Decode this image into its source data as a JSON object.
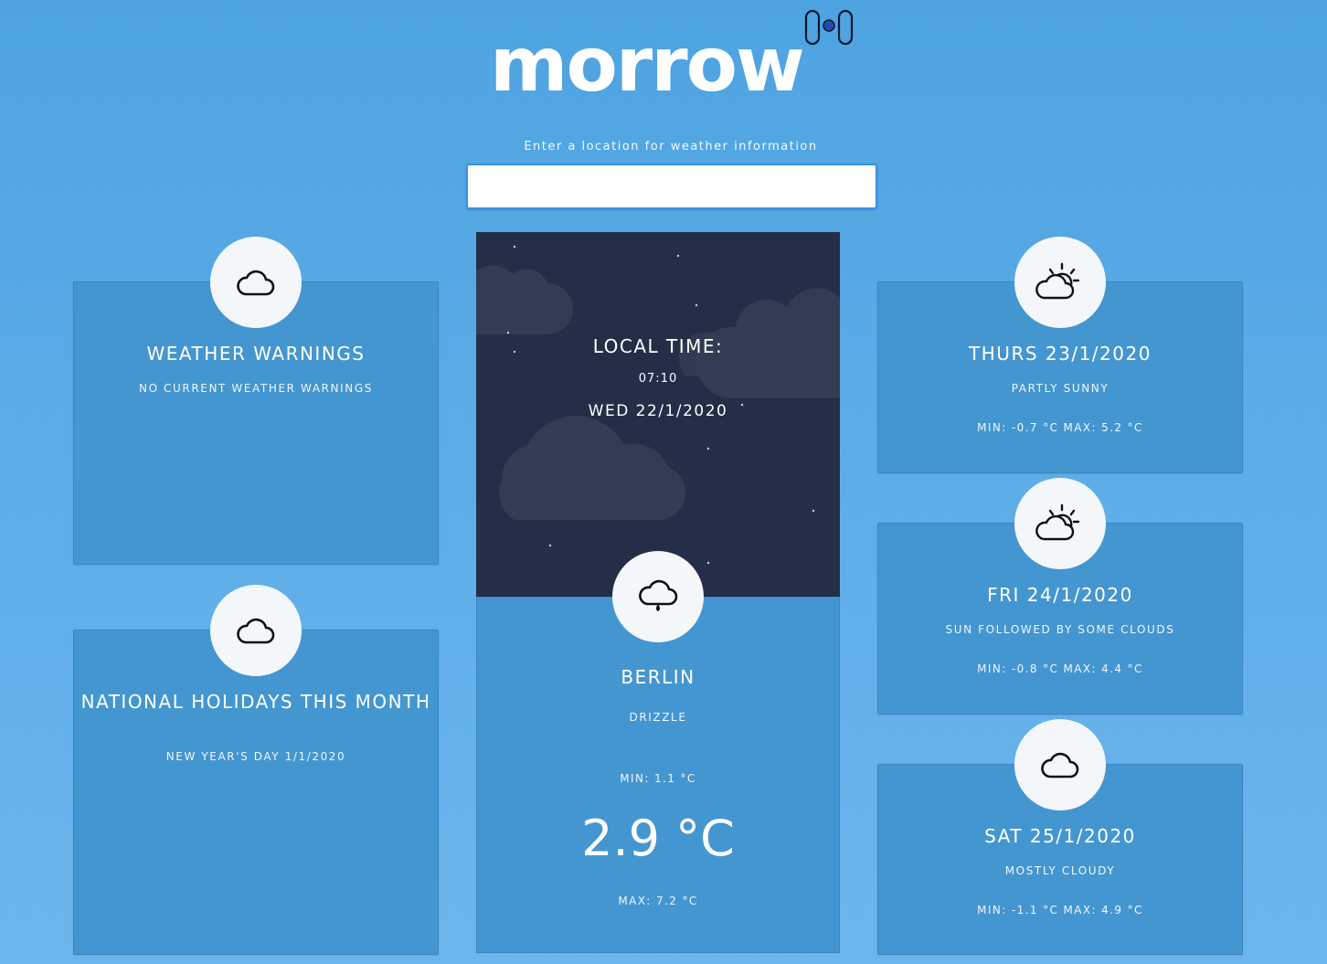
{
  "app": {
    "logo_text": "morrow"
  },
  "search": {
    "label": "Enter a location for weather information",
    "value": "",
    "placeholder": ""
  },
  "left_cards": [
    {
      "title": "Weather Warnings",
      "subtitle": "No current weather warnings",
      "icon": "cloud-icon"
    },
    {
      "title": "National Holidays this month",
      "subtitle": "New Year's Day 1/1/2020",
      "icon": "cloud-icon"
    }
  ],
  "local": {
    "label": "LOCAL TIME:",
    "time": "07:10",
    "date": "WED 22/1/2020",
    "scene": "night-sky-moon-clouds"
  },
  "current": {
    "city": "BERLIN",
    "condition": "DRIZZLE",
    "min": "MIN: 1.1 °C",
    "temp": "2.9 °C",
    "max": "MAX: 7.2 °C",
    "icon": "cloud-rain-icon"
  },
  "forecast": [
    {
      "day": "THURS 23/1/2020",
      "condition": "PARTLY SUNNY",
      "minmax": "MIN: -0.7 °C MAX: 5.2 °C",
      "icon": "partly-sunny-icon"
    },
    {
      "day": "FRI 24/1/2020",
      "condition": "SUN FOLLOWED BY SOME CLOUDS",
      "minmax": "MIN: -0.8 °C MAX: 4.4 °C",
      "icon": "partly-sunny-icon"
    },
    {
      "day": "SAT 25/1/2020",
      "condition": "MOSTLY CLOUDY",
      "minmax": "MIN: -1.1 °C MAX: 4.9 °C",
      "icon": "cloud-icon"
    }
  ],
  "colors": {
    "background": "#4da3e0",
    "card": "#4496d0",
    "night_sky": "#242e46",
    "moon": "#fbd87a",
    "icon_circle": "#f4f7fa"
  }
}
